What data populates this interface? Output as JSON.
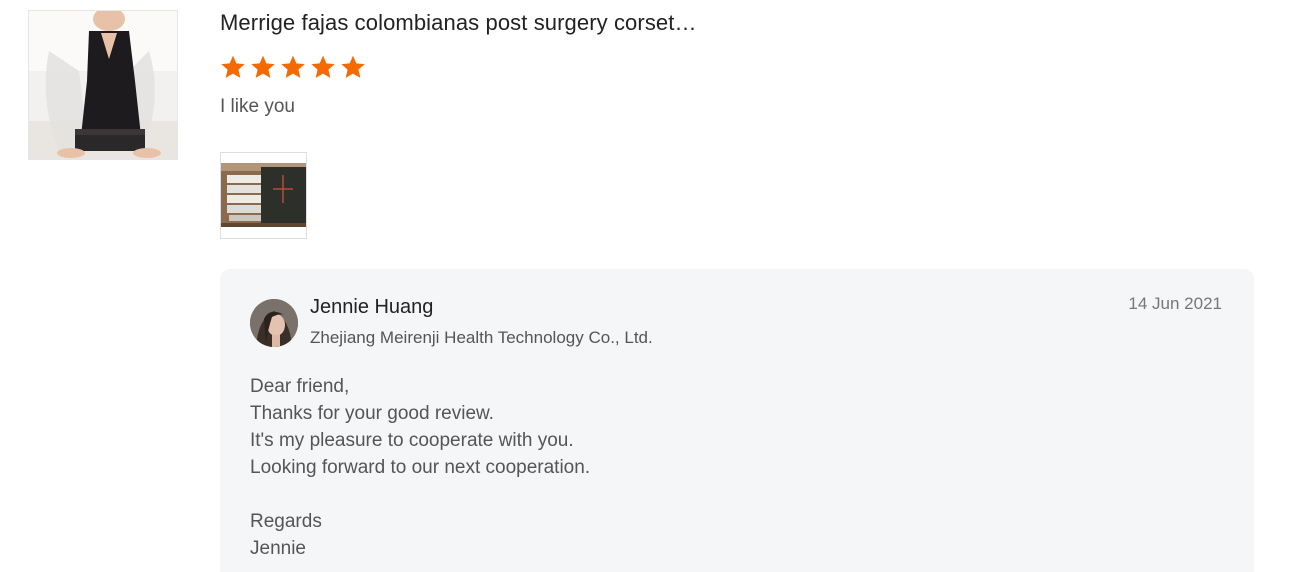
{
  "review": {
    "product_title": "Merrige fajas colombianas post surgery corset…",
    "rating": 5,
    "rating_max": 5,
    "star_color": "#f56a00",
    "text": "I like you"
  },
  "reply": {
    "seller_name": "Jennie Huang",
    "company": "Zhejiang Meirenji Health Technology Co., Ltd.",
    "date": "14 Jun 2021",
    "lines": [
      "Dear friend,",
      "Thanks for your good review.",
      "It's my pleasure to cooperate with you.",
      "Looking forward to our next cooperation.",
      "",
      "Regards",
      "Jennie"
    ]
  }
}
